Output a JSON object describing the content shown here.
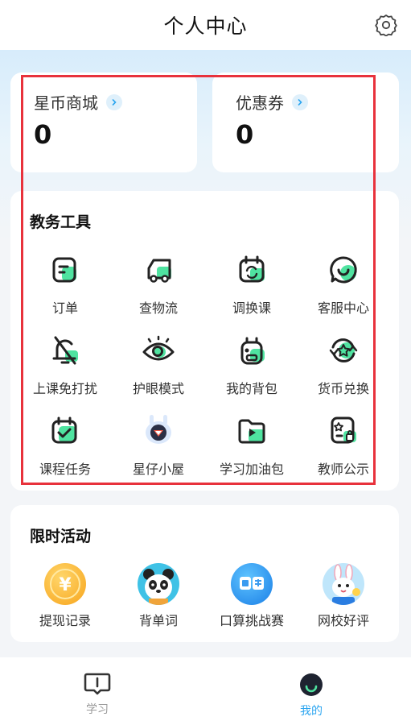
{
  "header": {
    "title": "个人中心",
    "settings_icon": "gear-icon"
  },
  "stats": [
    {
      "label": "星币商城",
      "value": "0"
    },
    {
      "label": "优惠券",
      "value": "0"
    }
  ],
  "tools": {
    "title": "教务工具",
    "items": [
      {
        "label": "订单",
        "icon": "order-icon"
      },
      {
        "label": "查物流",
        "icon": "truck-icon"
      },
      {
        "label": "调换课",
        "icon": "calendar-swap-icon"
      },
      {
        "label": "客服中心",
        "icon": "chat-bubble-icon"
      },
      {
        "label": "上课免打扰",
        "icon": "bell-off-icon"
      },
      {
        "label": "护眼模式",
        "icon": "eye-icon"
      },
      {
        "label": "我的背包",
        "icon": "backpack-icon"
      },
      {
        "label": "货币兑换",
        "icon": "exchange-icon"
      },
      {
        "label": "课程任务",
        "icon": "calendar-check-icon"
      },
      {
        "label": "星仔小屋",
        "icon": "robot-icon"
      },
      {
        "label": "学习加油包",
        "icon": "folder-play-icon"
      },
      {
        "label": "教师公示",
        "icon": "teacher-badge-icon"
      }
    ]
  },
  "activities": {
    "title": "限时活动",
    "items": [
      {
        "label": "提现记录",
        "icon": "yuan-coin-icon"
      },
      {
        "label": "背单词",
        "icon": "panda-icon"
      },
      {
        "label": "口算挑战赛",
        "icon": "calculator-icon"
      },
      {
        "label": "网校好评",
        "icon": "bunny-icon"
      }
    ]
  },
  "tabbar": {
    "items": [
      {
        "label": "学习",
        "icon": "study-icon",
        "active": false
      },
      {
        "label": "我的",
        "icon": "profile-icon",
        "active": true
      }
    ]
  },
  "colors": {
    "accent": "#2ba5f0",
    "icon_green": "#4fe3a0",
    "highlight": "#e8323c"
  }
}
